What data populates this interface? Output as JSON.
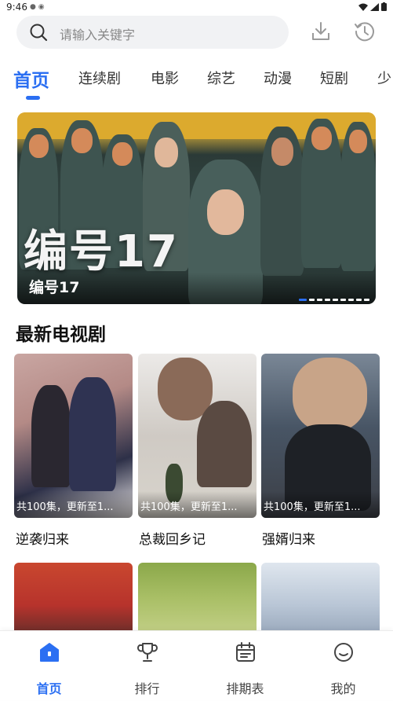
{
  "status_bar": {
    "time": "9:46"
  },
  "search": {
    "placeholder": "请输入关键字"
  },
  "tabs": [
    {
      "label": "首页",
      "active": true
    },
    {
      "label": "连续剧"
    },
    {
      "label": "电影"
    },
    {
      "label": "综艺"
    },
    {
      "label": "动漫"
    },
    {
      "label": "短剧"
    },
    {
      "label": "少"
    }
  ],
  "banner": {
    "poster_title": "编号17",
    "caption": "编号17",
    "slide_count": 9,
    "active_slide": 1
  },
  "section": {
    "title": "最新电视剧"
  },
  "cards": [
    {
      "title": "逆袭归来",
      "badge": "共100集，更新至1..."
    },
    {
      "title": "总裁回乡记",
      "badge": "共100集，更新至1..."
    },
    {
      "title": "强婿归来",
      "badge": "共100集，更新至1..."
    }
  ],
  "bottom_nav": [
    {
      "label": "首页",
      "icon": "home-icon",
      "active": true
    },
    {
      "label": "排行",
      "icon": "trophy-icon"
    },
    {
      "label": "排期表",
      "icon": "calendar-icon"
    },
    {
      "label": "我的",
      "icon": "profile-icon"
    }
  ],
  "colors": {
    "accent": "#2b6ff2",
    "search_bg": "#f1f2f4"
  }
}
